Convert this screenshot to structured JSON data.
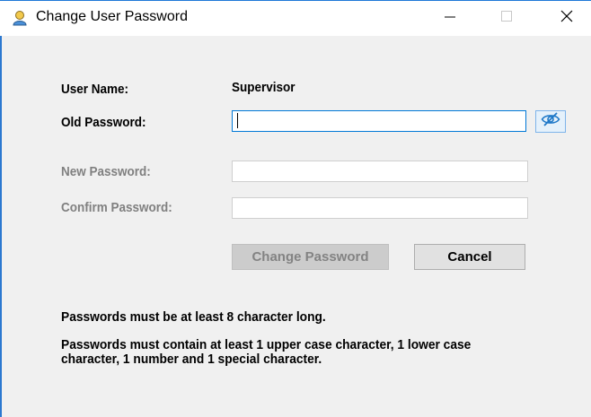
{
  "window": {
    "title": "Change User Password",
    "app_icon": "user-icon",
    "controls": {
      "minimize_icon": "minimize-icon",
      "maximize_icon": "maximize-icon",
      "close_icon": "close-icon"
    }
  },
  "form": {
    "user_name_label": "User Name:",
    "user_name_value": "Supervisor",
    "old_password_label": "Old Password:",
    "old_password_value": "",
    "show_password_icon": "eye-slash-icon",
    "new_password_label": "New Password:",
    "new_password_value": "",
    "confirm_password_label": "Confirm Password:",
    "confirm_password_value": ""
  },
  "buttons": {
    "change_password": "Change Password",
    "cancel": "Cancel"
  },
  "notes": {
    "length_rule": "Passwords must be at least 8 character long.",
    "complexity_rule": "Passwords must contain at least 1 upper case character, 1 lower case character, 1 number and 1 special character."
  },
  "colors": {
    "accent": "#0078d7",
    "window_bg": "#f0f0f0",
    "disabled_text": "#808080"
  }
}
